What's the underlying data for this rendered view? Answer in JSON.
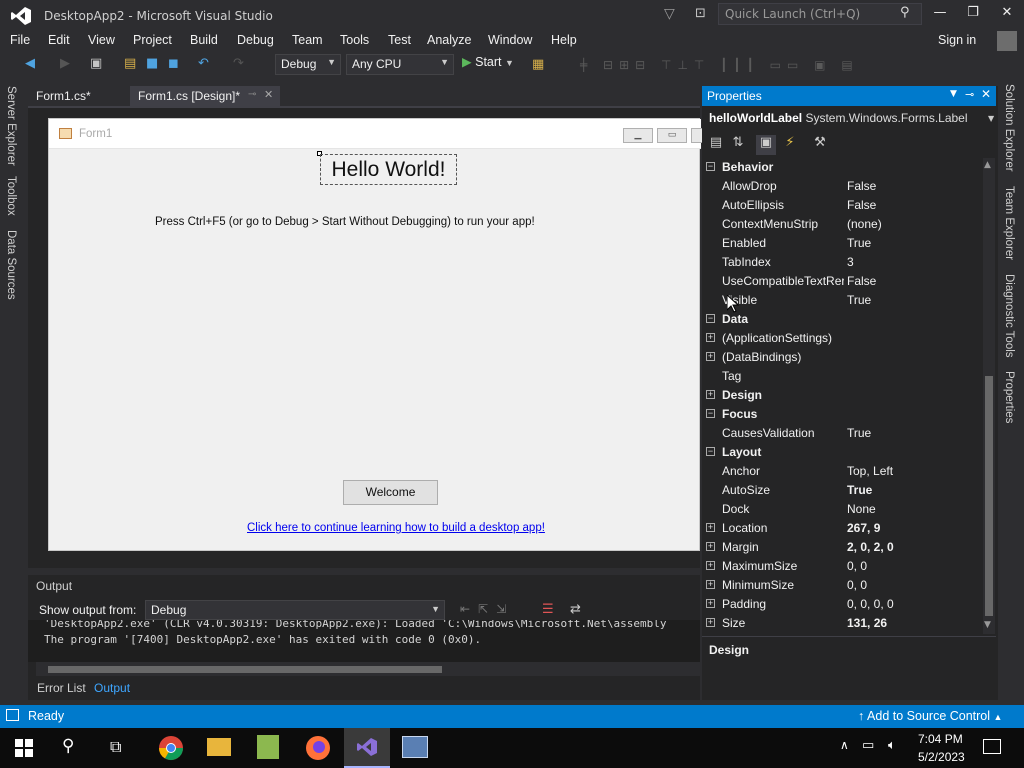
{
  "window": {
    "title": "DesktopApp2 - Microsoft Visual Studio",
    "quick_launch_placeholder": "Quick Launch (Ctrl+Q)"
  },
  "menu": [
    "File",
    "Edit",
    "View",
    "Project",
    "Build",
    "Debug",
    "Team",
    "Tools",
    "Test",
    "Analyze",
    "Window",
    "Help"
  ],
  "sign_in": "Sign in",
  "toolbar": {
    "config": "Debug",
    "platform": "Any CPU",
    "start": "Start"
  },
  "left_tabs": [
    "Server Explorer",
    "Toolbox",
    "Data Sources"
  ],
  "right_tabs": [
    "Solution Explorer",
    "Team Explorer",
    "Diagnostic Tools",
    "Properties"
  ],
  "doc_tabs": [
    {
      "label": "Form1.cs*"
    },
    {
      "label": "Form1.cs [Design]*"
    }
  ],
  "form": {
    "title": "Form1",
    "hello_label": "Hello World!",
    "instruction": "Press Ctrl+F5 (or go to Debug > Start Without Debugging) to run your app!",
    "welcome_button": "Welcome",
    "link": "Click here to continue learning how to build a desktop app!"
  },
  "output": {
    "header": "Output",
    "show_from_label": "Show output from:",
    "source": "Debug",
    "lines": [
      "'DesktopApp2.exe' (CLR v4.0.30319: DesktopApp2.exe): Loaded 'C:\\Windows\\Microsoft.Net\\assembly",
      "The program '[7400] DesktopApp2.exe' has exited with code 0 (0x0)."
    ]
  },
  "bottom_tabs": [
    "Error List",
    "Output"
  ],
  "properties": {
    "title": "Properties",
    "object_name": "helloWorldLabel",
    "object_type": "System.Windows.Forms.Label",
    "rows": [
      {
        "name": "Behavior",
        "value": "",
        "cat": true,
        "exp": "−"
      },
      {
        "name": "AllowDrop",
        "value": "False"
      },
      {
        "name": "AutoEllipsis",
        "value": "False"
      },
      {
        "name": "ContextMenuStrip",
        "value": "(none)"
      },
      {
        "name": "Enabled",
        "value": "True"
      },
      {
        "name": "TabIndex",
        "value": "3"
      },
      {
        "name": "UseCompatibleTextRer",
        "value": "False"
      },
      {
        "name": "Visible",
        "value": "True"
      },
      {
        "name": "Data",
        "value": "",
        "cat": true,
        "exp": "−"
      },
      {
        "name": "(ApplicationSettings)",
        "value": "",
        "exp": "+"
      },
      {
        "name": "(DataBindings)",
        "value": "",
        "exp": "+"
      },
      {
        "name": "Tag",
        "value": ""
      },
      {
        "name": "Design",
        "value": "",
        "cat": true,
        "exp": "+"
      },
      {
        "name": "Focus",
        "value": "",
        "cat": true,
        "exp": "−"
      },
      {
        "name": "CausesValidation",
        "value": "True"
      },
      {
        "name": "Layout",
        "value": "",
        "cat": true,
        "exp": "−"
      },
      {
        "name": "Anchor",
        "value": "Top, Left"
      },
      {
        "name": "AutoSize",
        "value": "True",
        "bold": true
      },
      {
        "name": "Dock",
        "value": "None"
      },
      {
        "name": "Location",
        "value": "267, 9",
        "bold": true,
        "exp": "+"
      },
      {
        "name": "Margin",
        "value": "2, 0, 2, 0",
        "bold": true,
        "exp": "+"
      },
      {
        "name": "MaximumSize",
        "value": "0, 0",
        "exp": "+"
      },
      {
        "name": "MinimumSize",
        "value": "0, 0",
        "exp": "+"
      },
      {
        "name": "Padding",
        "value": "0, 0, 0, 0",
        "exp": "+"
      },
      {
        "name": "Size",
        "value": "131, 26",
        "bold": true,
        "exp": "+"
      }
    ],
    "description_title": "Design"
  },
  "status": {
    "text": "Ready",
    "source_control": "Add to Source Control"
  },
  "taskbar": {
    "time": "7:04 PM",
    "date": "5/2/2023"
  },
  "colors": {
    "accent": "#007acc",
    "background": "#2d2d30"
  }
}
